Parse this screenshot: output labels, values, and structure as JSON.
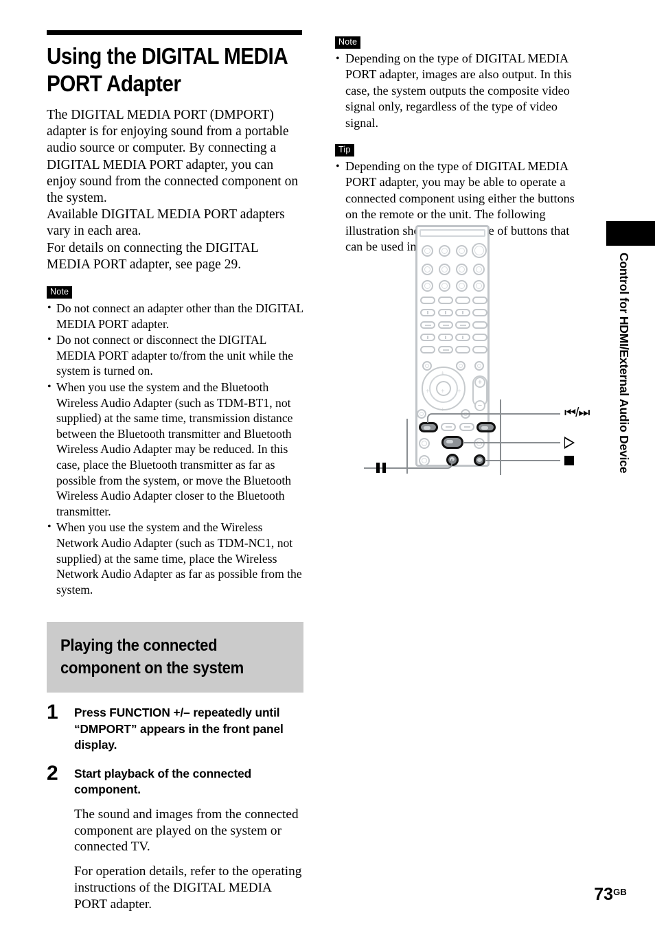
{
  "page": {
    "number": "73",
    "number_suffix": "GB"
  },
  "side_tab": {
    "label": "Control for HDMI/External Audio Device"
  },
  "title": "Using the DIGITAL MEDIA PORT Adapter",
  "intro_paragraphs": [
    "The DIGITAL MEDIA PORT (DMPORT) adapter is for enjoying sound from a portable audio source or computer. By connecting a DIGITAL MEDIA PORT adapter, you can enjoy sound from the connected component on the system.",
    "Available DIGITAL MEDIA PORT adapters vary in each area.",
    "For details on connecting the DIGITAL MEDIA PORT adapter, see page 29."
  ],
  "left_note": {
    "badge": "Note",
    "bullets": [
      "Do not connect an adapter other than the DIGITAL MEDIA PORT adapter.",
      "Do not connect or disconnect the DIGITAL MEDIA PORT adapter to/from the unit while the system is turned on.",
      "When you use the system and the Bluetooth Wireless Audio Adapter (such as TDM-BT1, not supplied) at the same time, transmission distance between the Bluetooth transmitter and Bluetooth Wireless Audio Adapter may be reduced. In this case, place the Bluetooth transmitter as far as possible from the system, or move the Bluetooth Wireless Audio Adapter closer to the Bluetooth transmitter.",
      "When you use the system and the Wireless Network Audio Adapter (such as TDM-NC1, not supplied) at the same time, place the Wireless Network Audio Adapter as far as possible from the system."
    ]
  },
  "section_header": {
    "line1": "Playing the connected",
    "line2": "component on the system"
  },
  "steps": [
    {
      "number": "1",
      "text": "Press FUNCTION +/– repeatedly until “DMPORT” appears in the front panel display.",
      "body": []
    },
    {
      "number": "2",
      "text": "Start playback of the connected component.",
      "body": [
        "The sound and images from the connected component are played on the system or connected TV.",
        "For operation details, refer to the operating instructions of the DIGITAL MEDIA PORT adapter."
      ]
    }
  ],
  "right_note": {
    "badge": "Note",
    "bullets": [
      "Depending on the type of DIGITAL MEDIA PORT adapter, images are also output. In this case, the system outputs the composite video signal only, regardless of the type of video signal."
    ]
  },
  "right_tip": {
    "badge": "Tip",
    "bullets": [
      "Depending on the type of DIGITAL MEDIA PORT adapter, you may be able to operate a connected component using either the buttons on the remote or the unit. The following illustration shows an example of buttons that can be used in this case."
    ]
  },
  "remote_figure": {
    "callouts": {
      "skip": "▮◀◀/▶▶▮",
      "play": "play-triangle",
      "stop": "stop-square",
      "pause": "pause-bars"
    }
  },
  "colors": {
    "section_header_bg": "#cbcbcb",
    "badge_bg": "#000000",
    "remote_outline": "#c2c6ca",
    "leader_line": "#8a8e92",
    "highlight_button": "#111111"
  }
}
